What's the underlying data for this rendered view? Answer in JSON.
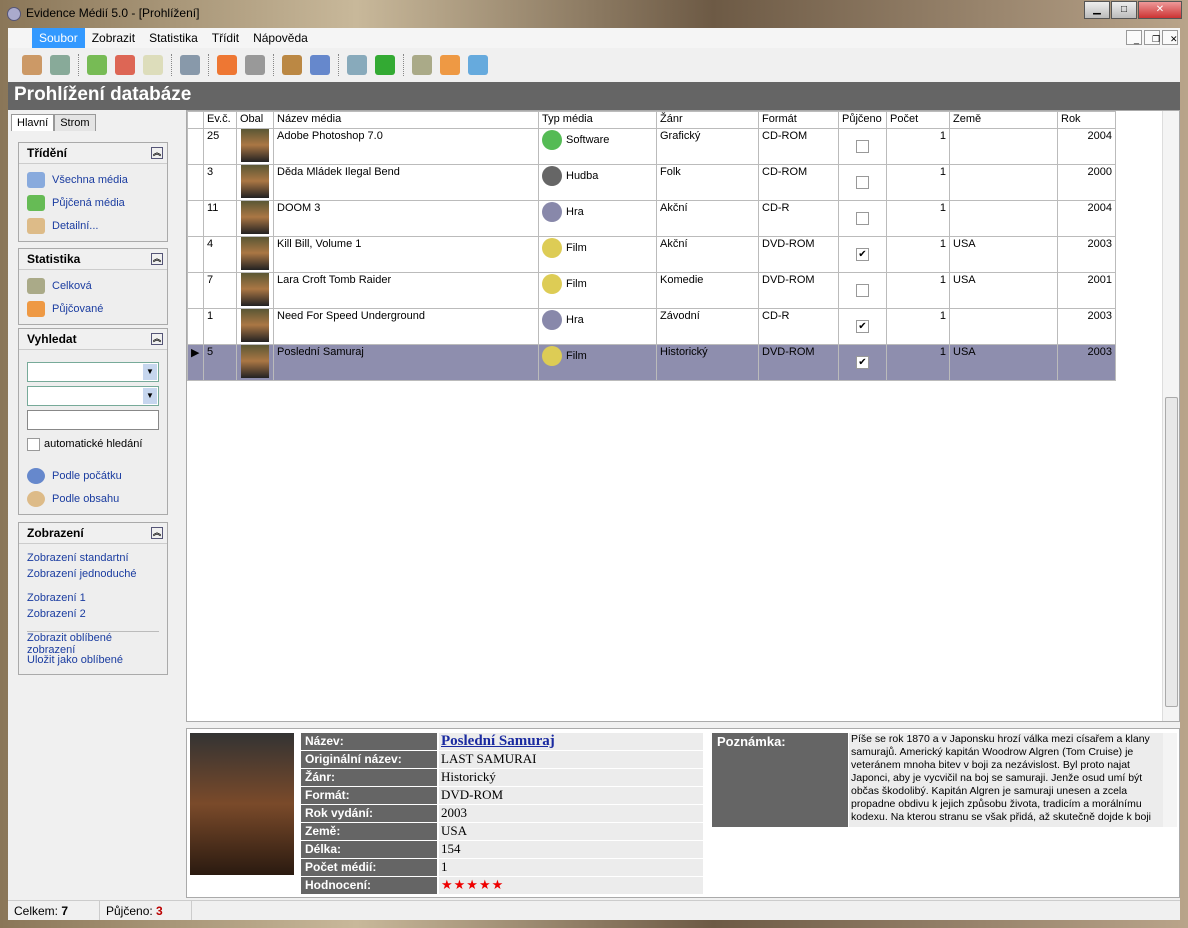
{
  "window": {
    "title": "Evidence Médií 5.0 - [Prohlížení]"
  },
  "menu": [
    "Soubor",
    "Zobrazit",
    "Statistika",
    "Třídit",
    "Nápověda"
  ],
  "header": "Prohlížení databáze",
  "tabs": [
    "Hlavní",
    "Strom"
  ],
  "panels": {
    "trideni": {
      "title": "Třídění",
      "items": [
        "Všechna média",
        "Půjčená média",
        "Detailní..."
      ]
    },
    "statistika": {
      "title": "Statistika",
      "items": [
        "Celková",
        "Půjčované"
      ]
    },
    "vyhledat": {
      "title": "Vyhledat",
      "auto": "automatické hledání",
      "items": [
        "Podle počátku",
        "Podle obsahu"
      ]
    },
    "zobrazeni": {
      "title": "Zobrazení",
      "items": [
        "Zobrazení standartní",
        "Zobrazení jednoduché",
        "Zobrazení 1",
        "Zobrazení 2",
        "Zobrazit oblíbené zobrazení",
        "Uložit jako oblíbené"
      ]
    }
  },
  "columns": [
    "Ev.č.",
    "Obal",
    "Název média",
    "Typ média",
    "Žánr",
    "Formát",
    "Půjčeno",
    "Počet",
    "Země",
    "Rok"
  ],
  "rows": [
    {
      "ev": "25",
      "name": "Adobe Photoshop 7.0",
      "type": "Software",
      "genre": "Grafický",
      "format": "CD-ROM",
      "borrowed": false,
      "count": "1",
      "country": "",
      "year": "2004"
    },
    {
      "ev": "3",
      "name": "Děda Mládek Ilegal Bend",
      "type": "Hudba",
      "genre": "Folk",
      "format": "CD-ROM",
      "borrowed": false,
      "count": "1",
      "country": "",
      "year": "2000"
    },
    {
      "ev": "11",
      "name": "DOOM 3",
      "type": "Hra",
      "genre": "Akční",
      "format": "CD-R",
      "borrowed": false,
      "count": "1",
      "country": "",
      "year": "2004"
    },
    {
      "ev": "4",
      "name": "Kill Bill, Volume 1",
      "type": "Film",
      "genre": "Akční",
      "format": "DVD-ROM",
      "borrowed": true,
      "count": "1",
      "country": "USA",
      "year": "2003"
    },
    {
      "ev": "7",
      "name": "Lara Croft Tomb Raider",
      "type": "Film",
      "genre": "Komedie",
      "format": "DVD-ROM",
      "borrowed": false,
      "count": "1",
      "country": "USA",
      "year": "2001"
    },
    {
      "ev": "1",
      "name": "Need For Speed Underground",
      "type": "Hra",
      "genre": "Závodní",
      "format": "CD-R",
      "borrowed": true,
      "count": "1",
      "country": "",
      "year": "2003"
    },
    {
      "ev": "5",
      "name": "Poslední Samuraj",
      "type": "Film",
      "genre": "Historický",
      "format": "DVD-ROM",
      "borrowed": true,
      "count": "1",
      "country": "USA",
      "year": "2003",
      "selected": true
    }
  ],
  "detail": {
    "fields": [
      {
        "label": "Název:",
        "value": "Poslední Samuraj"
      },
      {
        "label": "Originální název:",
        "value": "LAST SAMURAI"
      },
      {
        "label": "Žánr:",
        "value": "Historický"
      },
      {
        "label": "Formát:",
        "value": "DVD-ROM"
      },
      {
        "label": "Rok vydání:",
        "value": "2003"
      },
      {
        "label": "Země:",
        "value": "USA"
      },
      {
        "label": "Délka:",
        "value": "154"
      },
      {
        "label": "Počet médií:",
        "value": "1"
      },
      {
        "label": "Hodnocení:",
        "value": "★★★★★"
      }
    ],
    "note_label": "Poznámka:",
    "note": "Píše se rok 1870 a v Japonsku hrozí válka mezi císařem a klany samurajů. Americký kapitán Woodrow Algren (Tom Cruise) je veteránem mnoha bitev v boji za nezávislost. Byl proto najat Japonci, aby je vycvičil na boj se samuraji. Jenže osud umí být občas škodolibý. Kapitán Algren je samuraji unesen a zcela propadne obdivu k jejich způsobu života, tradicím a morálnímu kodexu. Na kterou stranu se však přidá, až skutečně dojde k boji"
  },
  "status": {
    "total_label": "Celkem:",
    "total": "7",
    "borrowed_label": "Půjčeno:",
    "borrowed": "3"
  }
}
